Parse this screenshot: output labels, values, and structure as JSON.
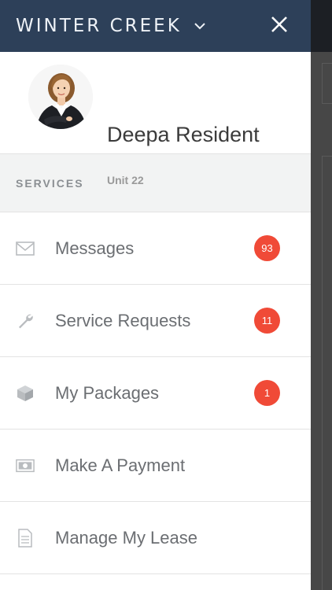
{
  "header": {
    "community_name": "WINTER CREEK",
    "icons": {
      "dropdown": "chevron-down-icon",
      "close": "close-icon"
    },
    "background_color": "#2d4059"
  },
  "profile": {
    "name": "Deepa Resident",
    "unit": "Unit 22"
  },
  "section": {
    "label": "SERVICES"
  },
  "menu": {
    "items": [
      {
        "label": "Messages",
        "icon": "envelope-icon",
        "badge": "93"
      },
      {
        "label": "Service Requests",
        "icon": "wrench-icon",
        "badge": "11"
      },
      {
        "label": "My Packages",
        "icon": "package-icon",
        "badge": "1"
      },
      {
        "label": "Make A Payment",
        "icon": "payment-icon",
        "badge": null
      },
      {
        "label": "Manage My Lease",
        "icon": "document-icon",
        "badge": null
      }
    ]
  },
  "colors": {
    "badge": "#f04a37",
    "menu_text": "#6b6e72"
  }
}
